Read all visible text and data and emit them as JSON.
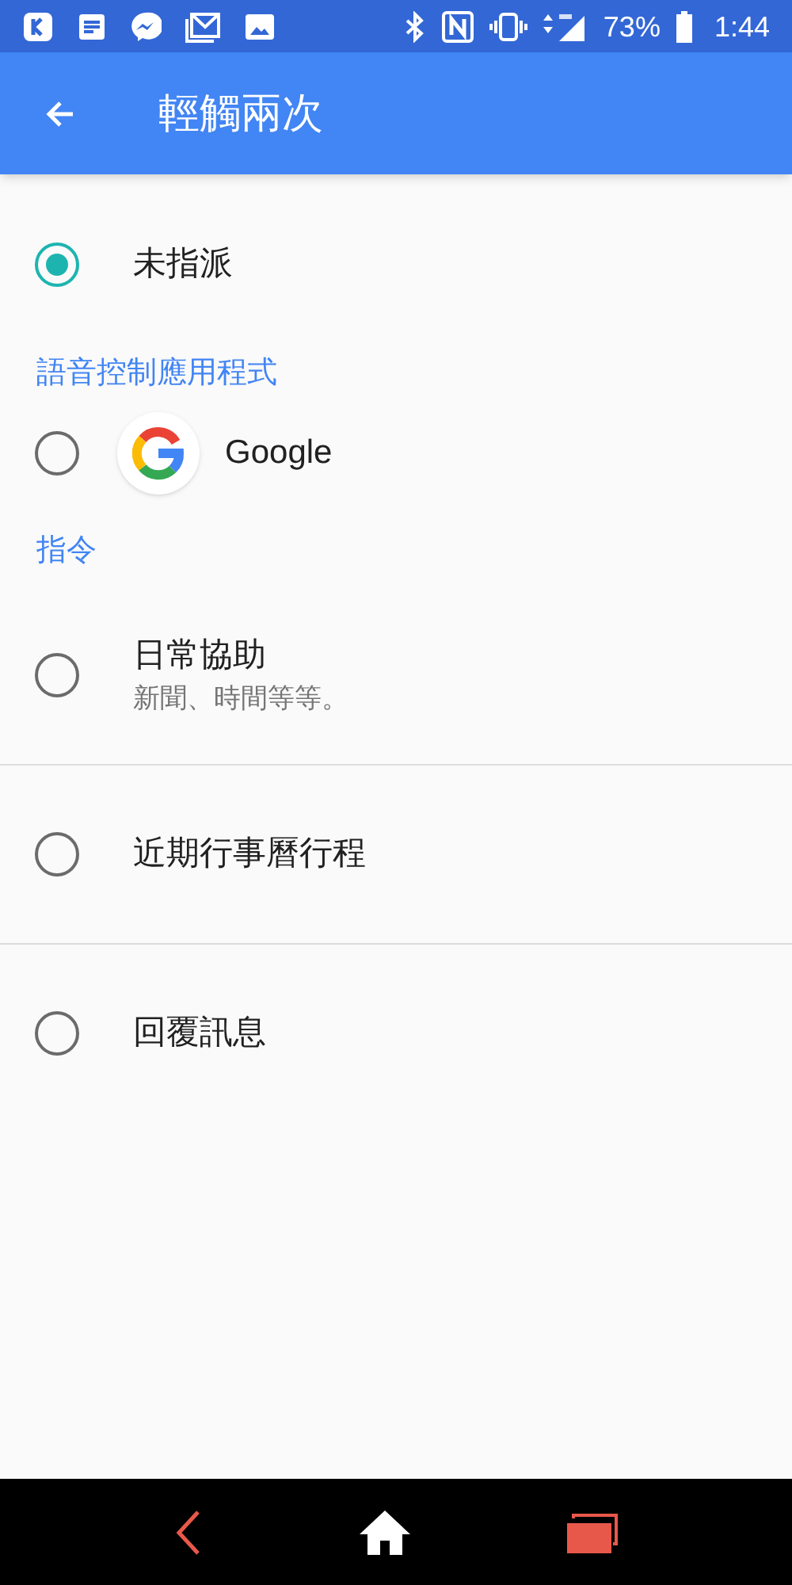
{
  "status_bar": {
    "battery_text": "73%",
    "time": "1:44"
  },
  "app_bar": {
    "title": "輕觸兩次"
  },
  "items": [
    {
      "kind": "option",
      "label": "未指派",
      "selected": true
    },
    {
      "kind": "header",
      "label": "語音控制應用程式"
    },
    {
      "kind": "option",
      "label": "Google",
      "selected": false,
      "app_icon": true
    },
    {
      "kind": "header",
      "label": "指令"
    },
    {
      "kind": "option",
      "label": "日常協助",
      "subtitle": "新聞、時間等等。",
      "selected": false
    },
    {
      "kind": "divider"
    },
    {
      "kind": "option",
      "label": "近期行事曆行程",
      "selected": false
    },
    {
      "kind": "divider"
    },
    {
      "kind": "option",
      "label": "回覆訊息",
      "selected": false
    }
  ]
}
